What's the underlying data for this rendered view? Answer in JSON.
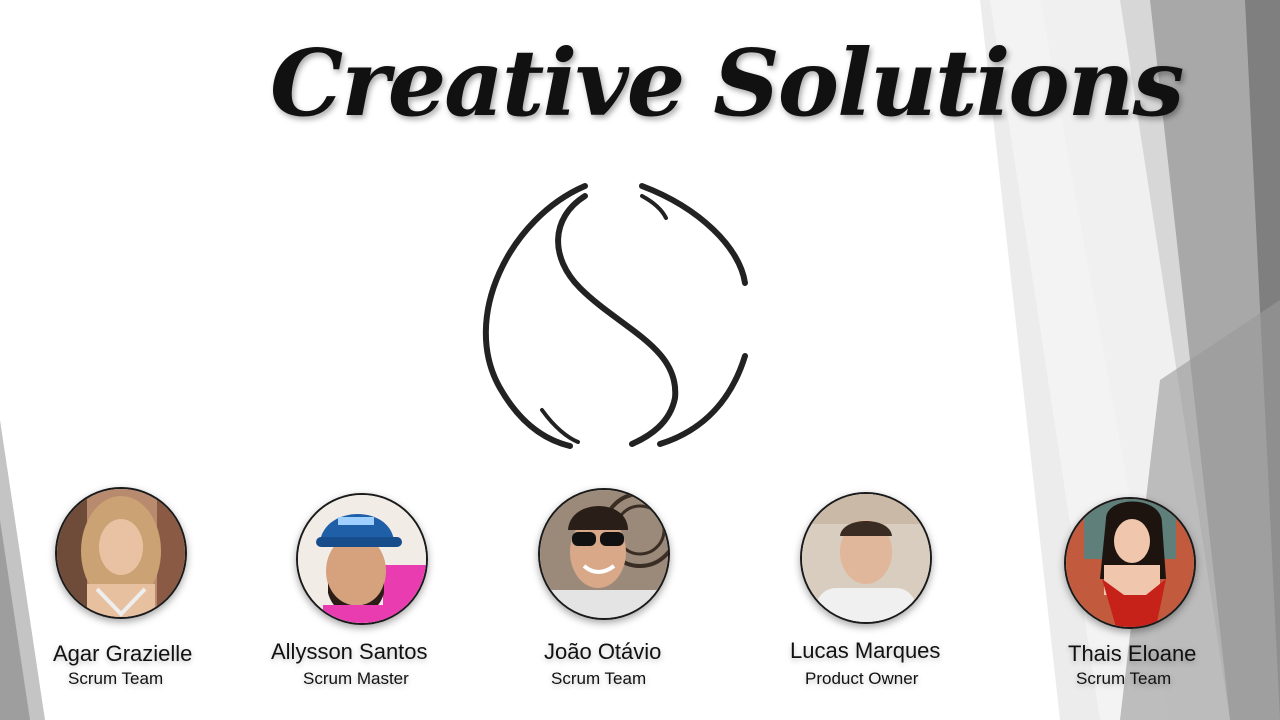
{
  "slide": {
    "title": "Creative Solutions",
    "logo_icon": "cs-swirl-logo-icon",
    "colors": {
      "background": "#ffffff",
      "shape_light": "#e6e6e6",
      "shape_mid": "#bdbdbd",
      "shape_dark": "#8c8c8c",
      "text": "#111111"
    }
  },
  "team": [
    {
      "name": "Agar Grazielle",
      "role": "Scrum Team"
    },
    {
      "name": "Allysson Santos",
      "role": "Scrum Master"
    },
    {
      "name": "João Otávio",
      "role": "Scrum Team"
    },
    {
      "name": "Lucas Marques",
      "role": "Product Owner"
    },
    {
      "name": "Thais Eloane",
      "role": "Scrum Team"
    }
  ]
}
